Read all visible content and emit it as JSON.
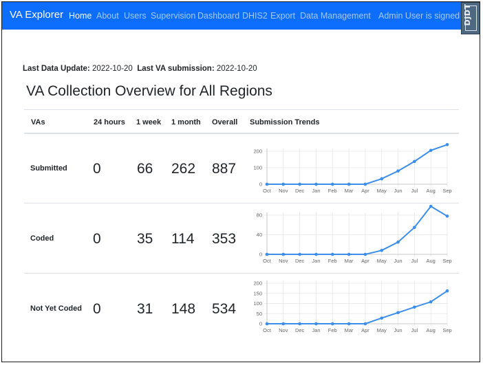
{
  "navbar": {
    "brand": "VA Explorer",
    "links": [
      {
        "label": "Home",
        "active": true
      },
      {
        "label": "About"
      },
      {
        "label": "Users"
      },
      {
        "label": "Supervision"
      },
      {
        "label": "Dashboard"
      },
      {
        "label": "DHIS2"
      },
      {
        "label": "Export"
      },
      {
        "label": "Data Management"
      }
    ],
    "signed_in": "Admin User is signed in.",
    "debug_toolbar": "DJDT"
  },
  "meta": {
    "last_update_label": "Last Data Update:",
    "last_update_value": "2022-10-20",
    "last_submission_label": "Last VA submission:",
    "last_submission_value": "2022-10-20"
  },
  "page_title": "VA Collection Overview for All Regions",
  "table": {
    "headers": [
      "VAs",
      "24 hours",
      "1 week",
      "1 month",
      "Overall",
      "Submission Trends"
    ],
    "rows": [
      {
        "label": "Submitted",
        "day": "0",
        "week": "66",
        "month": "262",
        "overall": "887"
      },
      {
        "label": "Coded",
        "day": "0",
        "week": "35",
        "month": "114",
        "overall": "353"
      },
      {
        "label": "Not Yet Coded",
        "day": "0",
        "week": "31",
        "month": "148",
        "overall": "534"
      }
    ]
  },
  "colors": {
    "navbar": "#0d6efd",
    "line": "#3b8eea",
    "grid": "#e6e6e6"
  },
  "chart_data": [
    {
      "type": "line",
      "categories": [
        "Oct",
        "Nov",
        "Dec",
        "Jan",
        "Feb",
        "Mar",
        "Apr",
        "May",
        "Jun",
        "Jul",
        "Aug",
        "Sep"
      ],
      "values": [
        0,
        0,
        0,
        0,
        0,
        0,
        0,
        33,
        80,
        138,
        205,
        240
      ],
      "ylim": [
        0,
        240
      ],
      "yticks": [
        0,
        100,
        200
      ],
      "grid": true
    },
    {
      "type": "line",
      "categories": [
        "Oct",
        "Nov",
        "Dec",
        "Jan",
        "Feb",
        "Mar",
        "Apr",
        "May",
        "Jun",
        "Jul",
        "Aug",
        "Sep"
      ],
      "values": [
        0,
        0,
        0,
        0,
        0,
        0,
        0,
        8,
        25,
        55,
        98,
        78
      ],
      "ylim": [
        0,
        100
      ],
      "yticks": [
        0,
        40,
        80
      ],
      "grid": true
    },
    {
      "type": "line",
      "categories": [
        "Oct",
        "Nov",
        "Dec",
        "Jan",
        "Feb",
        "Mar",
        "Apr",
        "May",
        "Jun",
        "Jul",
        "Aug",
        "Sep"
      ],
      "values": [
        0,
        0,
        0,
        0,
        0,
        0,
        0,
        28,
        55,
        82,
        108,
        162
      ],
      "ylim": [
        0,
        200
      ],
      "yticks": [
        0,
        50,
        100,
        150,
        200
      ],
      "grid": true
    }
  ]
}
